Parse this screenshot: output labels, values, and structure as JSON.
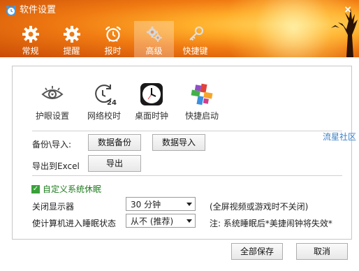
{
  "window": {
    "title": "软件设置",
    "close_label": "×"
  },
  "tabs": [
    {
      "label": "常规",
      "icon": "gear-icon"
    },
    {
      "label": "提醒",
      "icon": "gear-icon"
    },
    {
      "label": "报时",
      "icon": "alarm-clock-icon"
    },
    {
      "label": "高级",
      "icon": "gears-icon",
      "active": true
    },
    {
      "label": "快捷键",
      "icon": "key-icon"
    }
  ],
  "features": [
    {
      "label": "护眼设置",
      "icon": "eye-icon"
    },
    {
      "label": "网络校时",
      "icon": "clock-24-icon"
    },
    {
      "label": "桌面时钟",
      "icon": "desktop-clock-icon"
    },
    {
      "label": "快捷启动",
      "icon": "pinwheel-icon"
    }
  ],
  "backup": {
    "label": "备份\\导入:",
    "backup_button": "数据备份",
    "import_button": "数据导入"
  },
  "export": {
    "label": "导出到Excel",
    "button": "导出"
  },
  "sleep": {
    "checkbox_label": "自定义系统休眠",
    "checked": true,
    "display_off_label": "关闭显示器",
    "display_off_value": "30 分钟",
    "display_off_note": "(全屏视频或游戏时不关闭)",
    "sleep_label": "使计算机进入睡眠状态",
    "sleep_value": "从不 (推荐)",
    "sleep_note": "注: 系统睡眠后*美捷闹钟将失效*"
  },
  "side_link": "流星社区",
  "footer": {
    "save_all": "全部保存",
    "cancel": "取消"
  },
  "colors": {
    "header_orange": "#f07a12",
    "check_green": "#3aa13a",
    "link_blue": "#3b7fc4"
  }
}
